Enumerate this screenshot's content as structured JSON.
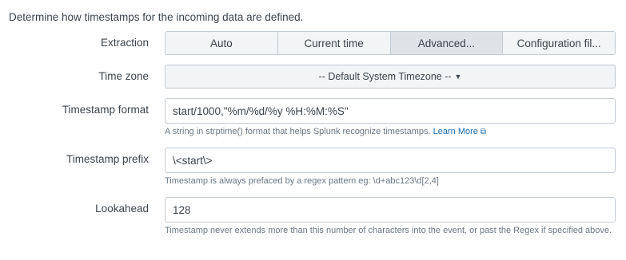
{
  "intro": "Determine how timestamps for the incoming data are defined.",
  "extraction": {
    "label": "Extraction",
    "options": [
      "Auto",
      "Current time",
      "Advanced...",
      "Configuration fil..."
    ],
    "selected": "Advanced..."
  },
  "timezone": {
    "label": "Time zone",
    "value": "-- Default System Timezone --"
  },
  "timestamp_format": {
    "label": "Timestamp format",
    "value": "start/1000,\"%m/%d/%y %H:%M:%S\"",
    "help": "A string in strptime() format that helps Splunk recognize timestamps.",
    "link": "Learn More"
  },
  "timestamp_prefix": {
    "label": "Timestamp prefix",
    "value": "\\<start\\>",
    "help": "Timestamp is always prefaced by a regex pattern eg: \\d+abc123\\d[2,4]"
  },
  "lookahead": {
    "label": "Lookahead",
    "value": "128",
    "help": "Timestamp never extends more than this number of characters into the event, or past the Regex if specified above."
  }
}
